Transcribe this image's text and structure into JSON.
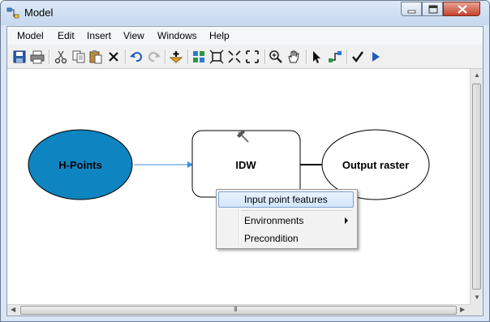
{
  "window": {
    "title": "Model"
  },
  "menu": [
    "Model",
    "Edit",
    "Insert",
    "View",
    "Windows",
    "Help"
  ],
  "toolbar_icons": [
    "save-icon",
    "print-icon",
    "cut-icon",
    "copy-icon",
    "paste-icon",
    "delete-icon",
    "undo-icon",
    "redo-icon",
    "add-data-icon",
    "auto-layout-icon",
    "full-extent-icon",
    "fixed-zoom-in-icon",
    "fixed-zoom-out-icon",
    "zoom-in-icon",
    "pan-icon",
    "select-icon",
    "connect-icon",
    "validate-icon",
    "run-icon"
  ],
  "nodes": {
    "input": {
      "label": "H-Points",
      "fill": "#0e84c0"
    },
    "tool": {
      "label": "IDW"
    },
    "output": {
      "label": "Output raster"
    }
  },
  "scroll": {
    "hscroll_label": "III"
  },
  "context_menu": {
    "items": [
      {
        "label": "Input point features",
        "highlighted": true
      },
      {
        "label": "Environments",
        "has_submenu": true
      },
      {
        "label": "Precondition"
      }
    ]
  },
  "colors": {
    "highlight_border": "#7da2ce",
    "connector": "#3a8ee6",
    "input_fill": "#0e84c0"
  }
}
